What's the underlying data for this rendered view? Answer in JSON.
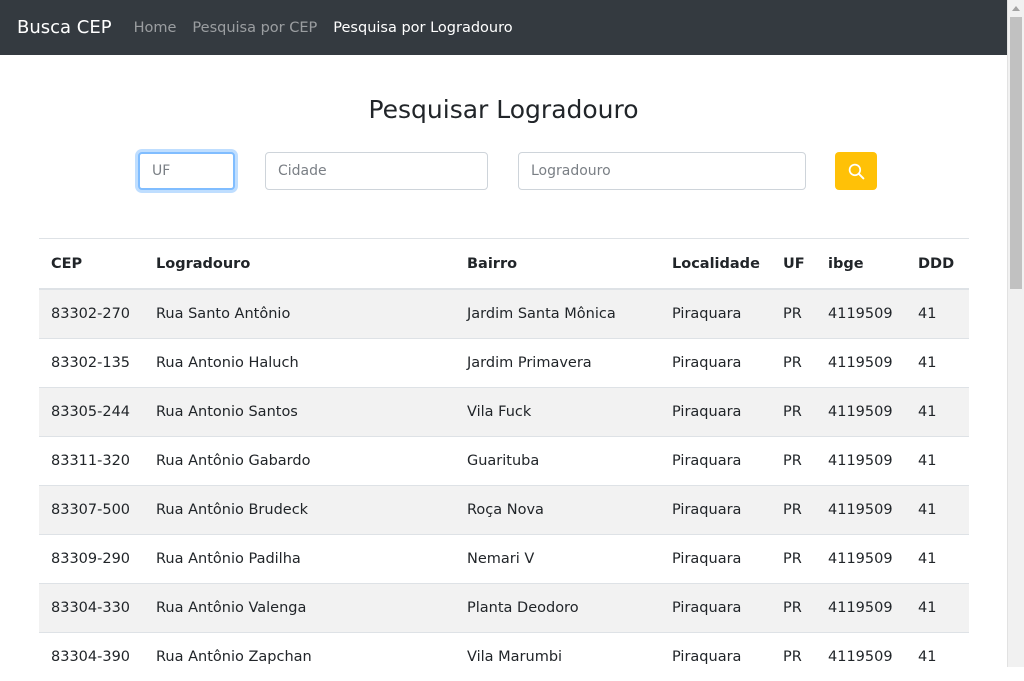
{
  "navbar": {
    "brand": "Busca CEP",
    "links": [
      {
        "label": "Home"
      },
      {
        "label": "Pesquisa por CEP"
      },
      {
        "label": "Pesquisa por Logradouro"
      }
    ]
  },
  "page": {
    "title": "Pesquisar Logradouro"
  },
  "form": {
    "uf_placeholder": "UF",
    "uf_value": "",
    "cidade_placeholder": "Cidade",
    "logradouro_placeholder": "Logradouro",
    "search_icon": "search-icon",
    "button_color": "#ffc107"
  },
  "table": {
    "headers": [
      "CEP",
      "Logradouro",
      "Bairro",
      "Localidade",
      "UF",
      "ibge",
      "DDD"
    ],
    "rows": [
      [
        "83302-270",
        "Rua Santo Antônio",
        "Jardim Santa Mônica",
        "Piraquara",
        "PR",
        "4119509",
        "41"
      ],
      [
        "83302-135",
        "Rua Antonio Haluch",
        "Jardim Primavera",
        "Piraquara",
        "PR",
        "4119509",
        "41"
      ],
      [
        "83305-244",
        "Rua Antonio Santos",
        "Vila Fuck",
        "Piraquara",
        "PR",
        "4119509",
        "41"
      ],
      [
        "83311-320",
        "Rua Antônio Gabardo",
        "Guarituba",
        "Piraquara",
        "PR",
        "4119509",
        "41"
      ],
      [
        "83307-500",
        "Rua Antônio Brudeck",
        "Roça Nova",
        "Piraquara",
        "PR",
        "4119509",
        "41"
      ],
      [
        "83309-290",
        "Rua Antônio Padilha",
        "Nemari V",
        "Piraquara",
        "PR",
        "4119509",
        "41"
      ],
      [
        "83304-330",
        "Rua Antônio Valenga",
        "Planta Deodoro",
        "Piraquara",
        "PR",
        "4119509",
        "41"
      ],
      [
        "83304-390",
        "Rua Antônio Zapchan",
        "Vila Marumbi",
        "Piraquara",
        "PR",
        "4119509",
        "41"
      ]
    ]
  },
  "colors": {
    "navbar": "#343a40",
    "accent": "#ffc107",
    "focus": "#80bdff"
  }
}
